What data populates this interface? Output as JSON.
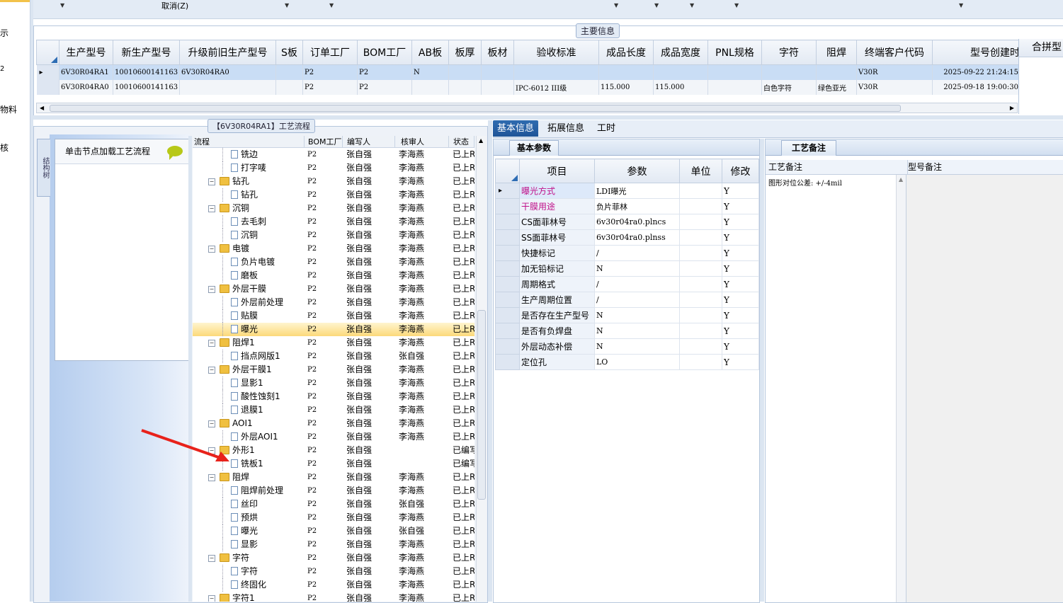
{
  "left_strip": {
    "items": [
      "示",
      "2",
      "物料",
      "核"
    ]
  },
  "toolbar": {
    "cancel_label": "取消(Z)"
  },
  "main_info": {
    "caption": "主要信息",
    "extra_header": "合拼型",
    "columns": [
      "生产型号",
      "新生产型号",
      "升级前旧生产型号",
      "S板",
      "订单工厂",
      "BOM工厂",
      "AB板",
      "板厚",
      "板材",
      "验收标准",
      "成品长度",
      "成品宽度",
      "PNL规格",
      "字符",
      "阻焊",
      "终端客户代码",
      "型号创建时"
    ],
    "rows": [
      [
        "6V30R04RA1",
        "10010600141163",
        "6V30R04RA0",
        "",
        "P2",
        "P2",
        "N",
        "",
        "",
        "",
        "",
        "",
        "",
        "",
        "",
        "V30R",
        "2025-09-22 21:24:15"
      ],
      [
        "6V30R04RA0",
        "10010600141163",
        "",
        "",
        "P2",
        "P2",
        "",
        "",
        "",
        "IPC-6012 III级",
        "115.000",
        "115.000",
        "",
        "白色字符",
        "绿色亚光",
        "V30R",
        "2025-09-18 19:00:30"
      ]
    ]
  },
  "process": {
    "caption": "【6V30R04RA1】工艺流程",
    "side_tab": "结构树",
    "load_hint": "单击节点加载工艺流程",
    "columns": [
      "流程",
      "BOM工厂",
      "编写人",
      "核审人",
      "状态"
    ],
    "rows": [
      {
        "name": "铣边",
        "level": 2,
        "bom": "P2",
        "writer": "张自强",
        "reviewer": "李海燕",
        "status": "已上R"
      },
      {
        "name": "打字唛",
        "level": 2,
        "bom": "P2",
        "writer": "张自强",
        "reviewer": "李海燕",
        "status": "已上R"
      },
      {
        "name": "钻孔",
        "level": 1,
        "bom": "P2",
        "writer": "张自强",
        "reviewer": "李海燕",
        "status": "已上R"
      },
      {
        "name": "钻孔",
        "level": 2,
        "bom": "P2",
        "writer": "张自强",
        "reviewer": "李海燕",
        "status": "已上R"
      },
      {
        "name": "沉铜",
        "level": 1,
        "bom": "P2",
        "writer": "张自强",
        "reviewer": "李海燕",
        "status": "已上R"
      },
      {
        "name": "去毛刺",
        "level": 2,
        "bom": "P2",
        "writer": "张自强",
        "reviewer": "李海燕",
        "status": "已上R"
      },
      {
        "name": "沉铜",
        "level": 2,
        "bom": "P2",
        "writer": "张自强",
        "reviewer": "李海燕",
        "status": "已上R"
      },
      {
        "name": "电镀",
        "level": 1,
        "bom": "P2",
        "writer": "张自强",
        "reviewer": "李海燕",
        "status": "已上R"
      },
      {
        "name": "负片电镀",
        "level": 2,
        "bom": "P2",
        "writer": "张自强",
        "reviewer": "李海燕",
        "status": "已上R"
      },
      {
        "name": "磨板",
        "level": 2,
        "bom": "P2",
        "writer": "张自强",
        "reviewer": "李海燕",
        "status": "已上R"
      },
      {
        "name": "外层干膜",
        "level": 1,
        "bom": "P2",
        "writer": "张自强",
        "reviewer": "李海燕",
        "status": "已上R"
      },
      {
        "name": "外层前处理",
        "level": 2,
        "bom": "P2",
        "writer": "张自强",
        "reviewer": "李海燕",
        "status": "已上R"
      },
      {
        "name": "贴膜",
        "level": 2,
        "bom": "P2",
        "writer": "张自强",
        "reviewer": "李海燕",
        "status": "已上R"
      },
      {
        "name": "曝光",
        "level": 2,
        "bom": "P2",
        "writer": "张自强",
        "reviewer": "李海燕",
        "status": "已上R",
        "selected": true
      },
      {
        "name": "阻焊1",
        "level": 1,
        "bom": "P2",
        "writer": "张自强",
        "reviewer": "李海燕",
        "status": "已上R"
      },
      {
        "name": "挡点网版1",
        "level": 2,
        "bom": "P2",
        "writer": "张自强",
        "reviewer": "张自强",
        "status": "已上R"
      },
      {
        "name": "外层干膜1",
        "level": 1,
        "bom": "P2",
        "writer": "张自强",
        "reviewer": "李海燕",
        "status": "已上R"
      },
      {
        "name": "显影1",
        "level": 2,
        "bom": "P2",
        "writer": "张自强",
        "reviewer": "李海燕",
        "status": "已上R"
      },
      {
        "name": "酸性蚀刻1",
        "level": 2,
        "bom": "P2",
        "writer": "张自强",
        "reviewer": "李海燕",
        "status": "已上R"
      },
      {
        "name": "退膜1",
        "level": 2,
        "bom": "P2",
        "writer": "张自强",
        "reviewer": "李海燕",
        "status": "已上R"
      },
      {
        "name": "AOI1",
        "level": 1,
        "bom": "P2",
        "writer": "张自强",
        "reviewer": "李海燕",
        "status": "已上R"
      },
      {
        "name": "外层AOI1",
        "level": 2,
        "bom": "P2",
        "writer": "张自强",
        "reviewer": "李海燕",
        "status": "已上R"
      },
      {
        "name": "外形1",
        "level": 1,
        "bom": "P2",
        "writer": "张自强",
        "reviewer": "",
        "status": "已编写"
      },
      {
        "name": "铣板1",
        "level": 2,
        "bom": "P2",
        "writer": "张自强",
        "reviewer": "",
        "status": "已编写"
      },
      {
        "name": "阻焊",
        "level": 1,
        "bom": "P2",
        "writer": "张自强",
        "reviewer": "李海燕",
        "status": "已上R"
      },
      {
        "name": "阻焊前处理",
        "level": 2,
        "bom": "P2",
        "writer": "张自强",
        "reviewer": "李海燕",
        "status": "已上R"
      },
      {
        "name": "丝印",
        "level": 2,
        "bom": "P2",
        "writer": "张自强",
        "reviewer": "张自强",
        "status": "已上R"
      },
      {
        "name": "预烘",
        "level": 2,
        "bom": "P2",
        "writer": "张自强",
        "reviewer": "李海燕",
        "status": "已上R"
      },
      {
        "name": "曝光",
        "level": 2,
        "bom": "P2",
        "writer": "张自强",
        "reviewer": "张自强",
        "status": "已上R"
      },
      {
        "name": "显影",
        "level": 2,
        "bom": "P2",
        "writer": "张自强",
        "reviewer": "李海燕",
        "status": "已上R"
      },
      {
        "name": "字符",
        "level": 1,
        "bom": "P2",
        "writer": "张自强",
        "reviewer": "李海燕",
        "status": "已上R"
      },
      {
        "name": "字符",
        "level": 2,
        "bom": "P2",
        "writer": "张自强",
        "reviewer": "李海燕",
        "status": "已上R"
      },
      {
        "name": "终固化",
        "level": 2,
        "bom": "P2",
        "writer": "张自强",
        "reviewer": "李海燕",
        "status": "已上R"
      },
      {
        "name": "字符1",
        "level": 1,
        "bom": "P2",
        "writer": "张自强",
        "reviewer": "李海燕",
        "status": "已上R"
      }
    ]
  },
  "info_tabs": [
    "基本信息",
    "拓展信息",
    "工时"
  ],
  "basic_params": {
    "title": "基本参数",
    "columns": [
      "项目",
      "参数",
      "单位",
      "修改"
    ],
    "rows": [
      {
        "item": "曝光方式",
        "value": "LDI曝光",
        "unit": "",
        "edit": "Y",
        "highlight": true
      },
      {
        "item": "干膜用途",
        "value": "负片菲林",
        "unit": "",
        "edit": "Y",
        "highlight": true
      },
      {
        "item": "CS面菲林号",
        "value": "6v30r04ra0.plncs",
        "unit": "",
        "edit": "Y"
      },
      {
        "item": "SS面菲林号",
        "value": "6v30r04ra0.plnss",
        "unit": "",
        "edit": "Y"
      },
      {
        "item": "快捷标记",
        "value": "/",
        "unit": "",
        "edit": "Y"
      },
      {
        "item": "加无铅标记",
        "value": "N",
        "unit": "",
        "edit": "Y"
      },
      {
        "item": "周期格式",
        "value": "/",
        "unit": "",
        "edit": "Y"
      },
      {
        "item": "生产周期位置",
        "value": "/",
        "unit": "",
        "edit": "Y"
      },
      {
        "item": "是否存在生产型号",
        "value": "N",
        "unit": "",
        "edit": "Y"
      },
      {
        "item": "是否有负焊盘",
        "value": "N",
        "unit": "",
        "edit": "Y"
      },
      {
        "item": "外层动态补偿",
        "value": "N",
        "unit": "",
        "edit": "Y"
      },
      {
        "item": "定位孔",
        "value": "LO",
        "unit": "",
        "edit": "Y"
      }
    ]
  },
  "notes": {
    "title": "工艺备注",
    "process_note_label": "工艺备注",
    "model_note_label": "型号备注",
    "process_note_text": "图形对位公差: +/-4mil"
  }
}
